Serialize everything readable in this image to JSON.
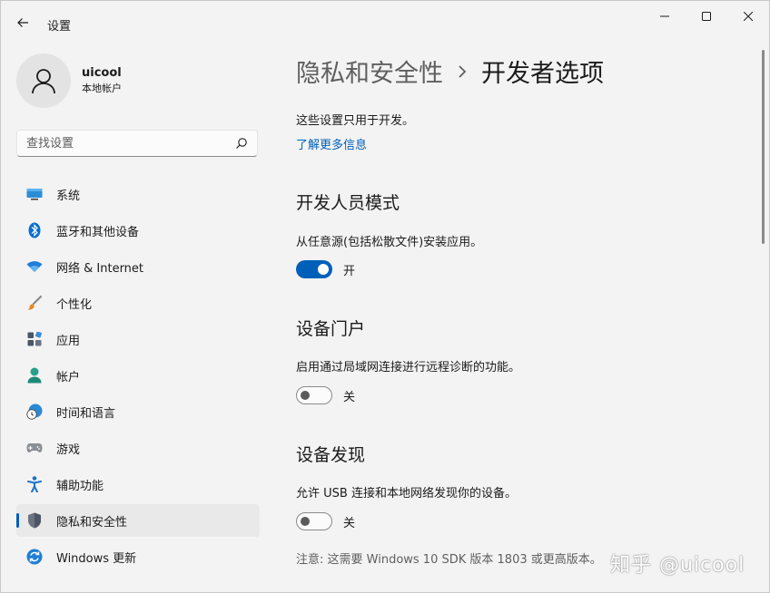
{
  "window": {
    "title": "设置"
  },
  "profile": {
    "name": "uicool",
    "account_type": "本地帐户"
  },
  "search": {
    "placeholder": "查找设置"
  },
  "nav": {
    "items": [
      {
        "label": "系统",
        "icon": "system-display-icon"
      },
      {
        "label": "蓝牙和其他设备",
        "icon": "bluetooth-icon"
      },
      {
        "label": "网络 & Internet",
        "icon": "wifi-icon"
      },
      {
        "label": "个性化",
        "icon": "brush-icon"
      },
      {
        "label": "应用",
        "icon": "apps-icon"
      },
      {
        "label": "帐户",
        "icon": "person-icon"
      },
      {
        "label": "时间和语言",
        "icon": "clock-globe-icon"
      },
      {
        "label": "游戏",
        "icon": "gamepad-icon"
      },
      {
        "label": "辅助功能",
        "icon": "accessibility-icon"
      },
      {
        "label": "隐私和安全性",
        "icon": "shield-icon",
        "selected": true
      },
      {
        "label": "Windows 更新",
        "icon": "update-icon"
      }
    ]
  },
  "breadcrumb": {
    "parent": "隐私和安全性",
    "current": "开发者选项"
  },
  "intro": {
    "text": "这些设置只用于开发。",
    "link": "了解更多信息"
  },
  "sections": [
    {
      "title": "开发人员模式",
      "description": "从任意源(包括松散文件)安装应用。",
      "toggle_on": true,
      "state_label": "开"
    },
    {
      "title": "设备门户",
      "description": "启用通过局域网连接进行远程诊断的功能。",
      "toggle_on": false,
      "state_label": "关"
    },
    {
      "title": "设备发现",
      "description": "允许 USB 连接和本地网络发现你的设备。",
      "toggle_on": false,
      "state_label": "关"
    }
  ],
  "note": "注意: 这需要 Windows 10 SDK 版本 1803 或更高版本。",
  "watermark": "知乎 @uicool",
  "colors": {
    "accent": "#005fb8",
    "background": "#f3f3f3",
    "selected_nav": "#e9e9e9"
  }
}
